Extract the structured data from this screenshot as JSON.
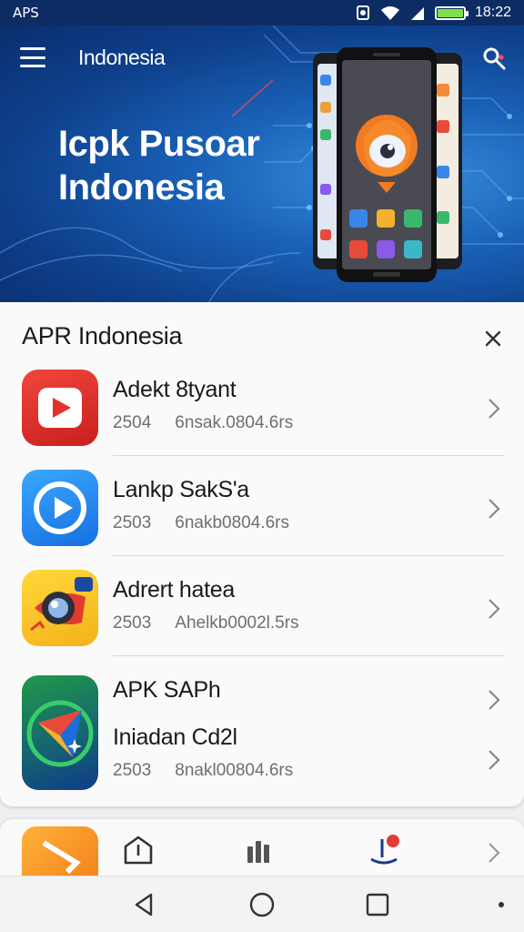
{
  "status_bar": {
    "left_label": "APS",
    "time": "18:22",
    "battery_level": 1.0,
    "icons": [
      "vibrate-icon",
      "wifi-icon",
      "signal-icon",
      "battery-icon"
    ]
  },
  "hero": {
    "top_title": "Indonesia",
    "headline_line1": "Icpk Pusoar",
    "headline_line2": "Indonesia",
    "icons": [
      "menu-icon",
      "search-user-icon"
    ]
  },
  "list": {
    "title": "APR Indonesia",
    "items": [
      {
        "name": "Adekt 8tyant",
        "version": "2504",
        "detail": "6nsak.0804.6rs",
        "icon": "video-play-icon",
        "color": "#e4312b"
      },
      {
        "name": "Lankp SakS'a",
        "version": "2503",
        "detail": "6nakb0804.6rs",
        "icon": "media-play-icon",
        "color": "#1e8ff0"
      },
      {
        "name": "Adrert hatea",
        "version": "2503",
        "detail": "Ahelkb0002l.5rs",
        "icon": "camera-lens-icon",
        "color": "#f8c61c"
      },
      {
        "name": "APK SAPh",
        "subtitle": "Iniadan Cd2l",
        "version": "2503",
        "detail": "8nakl00804.6rs",
        "icon": "google-play-style-icon",
        "color": "#1a7a3a"
      }
    ]
  },
  "bottom_nav": {
    "icons": [
      "home-tent-icon",
      "apps-bars-icon",
      "updates-badge-icon"
    ],
    "accent": "#e53935"
  },
  "system_nav": {
    "icons": [
      "back-icon",
      "home-circle-icon",
      "recents-square-icon"
    ]
  }
}
